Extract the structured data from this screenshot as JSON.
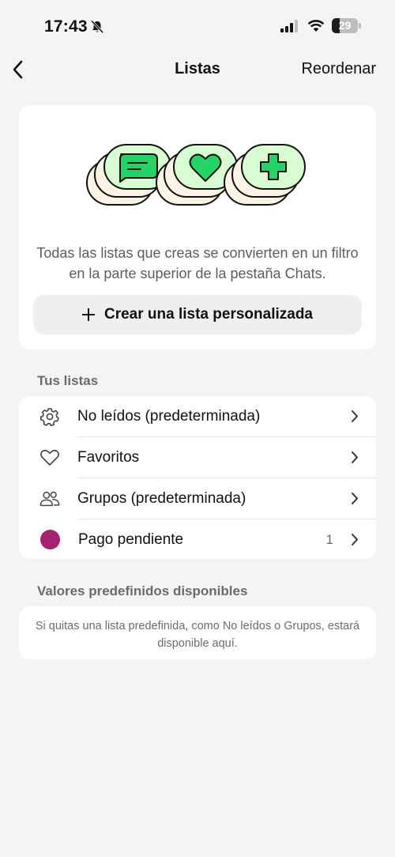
{
  "status_bar": {
    "time": "17:43",
    "battery": "29",
    "battery_level": 0.29
  },
  "nav": {
    "title": "Listas",
    "action": "Reordenar"
  },
  "hero": {
    "description": "Todas las listas que creas se convierten en un filtro en la parte superior de la pestaña Chats.",
    "create_button": "Crear una lista personalizada"
  },
  "your_lists": {
    "title": "Tus listas",
    "items": [
      {
        "label": "No leídos (predeterminada)",
        "icon": "gear-icon",
        "count": ""
      },
      {
        "label": "Favoritos",
        "icon": "heart-icon",
        "count": ""
      },
      {
        "label": "Grupos (predeterminada)",
        "icon": "people-icon",
        "count": ""
      },
      {
        "label": "Pago pendiente",
        "icon": "color-dot",
        "count": "1",
        "color": "#a3246e"
      }
    ]
  },
  "presets": {
    "title": "Valores predefinidos disponibles",
    "text": "Si quitas una lista predefinida, como No leídos o Grupos, estará disponible aquí."
  },
  "colors": {
    "background": "#f4f4f4",
    "card": "#ffffff",
    "accent_green": "#25d366",
    "list_dot": "#a3246e"
  }
}
